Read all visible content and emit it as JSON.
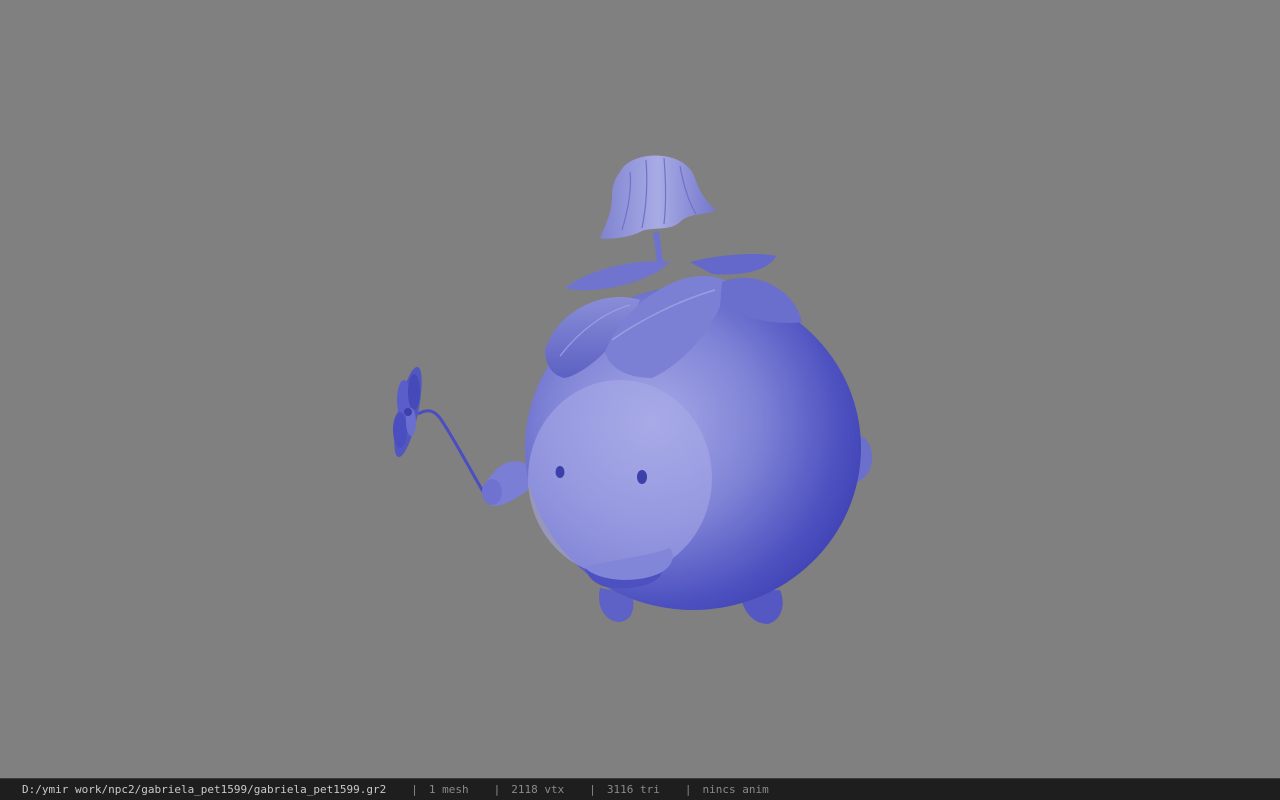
{
  "viewer": {
    "background_color": "#808080",
    "model_tint": "#5f62c4",
    "model_subject": "blueberry-pet-creature-with-mushroom-hat-and-flower"
  },
  "status_bar": {
    "file_path": "D:/ymir work/npc2/gabriela_pet1599/gabriela_pet1599.gr2",
    "separator": "|",
    "mesh_count": "1 mesh",
    "vertex_count": "2118 vtx",
    "triangle_count": "3116 tri",
    "anim_status": "nincs anim"
  }
}
